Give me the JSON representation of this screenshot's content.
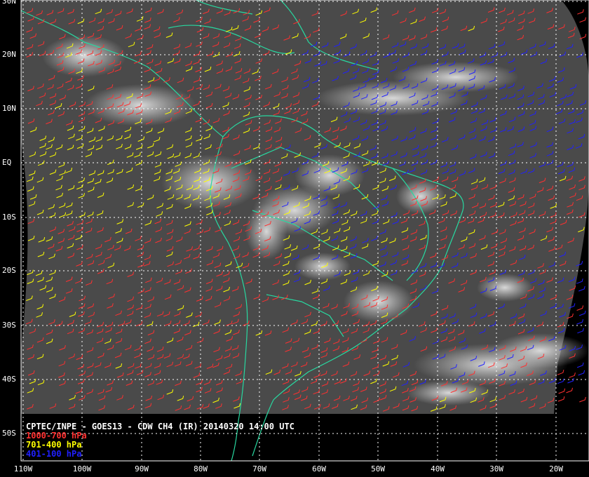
{
  "map": {
    "title": "CPTEC/INPE - GOES13 - CDW CH4 (IR) 20140320 14:00 UTC",
    "legend": [
      {
        "label": "1000-700 hPa",
        "color": "#ff3030"
      },
      {
        "label": "701-400 hPa",
        "color": "#ffff00"
      },
      {
        "label": "401-100 hPa",
        "color": "#2020ff"
      }
    ],
    "lat_labels": [
      "30N",
      "20N",
      "10N",
      "EQ",
      "10S",
      "20S",
      "30S",
      "40S",
      "50S"
    ],
    "lon_labels": [
      "110W",
      "100W",
      "90W",
      "80W",
      "70W",
      "60W",
      "50W",
      "40W",
      "30W",
      "20W"
    ],
    "coast_color": "#28d8a0",
    "grid_color": "#ffffff",
    "icons": [
      "wind-barb-icon"
    ]
  }
}
